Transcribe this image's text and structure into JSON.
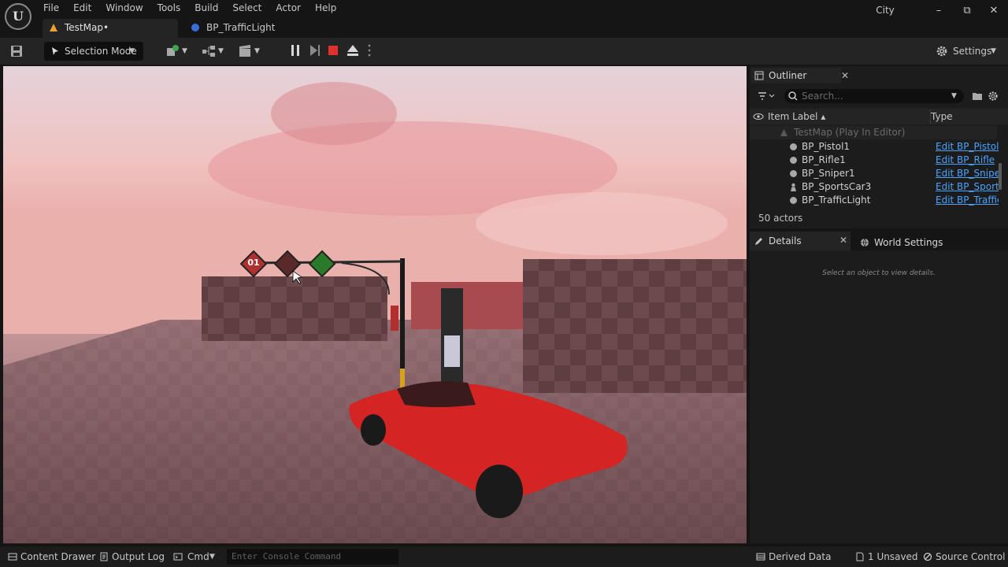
{
  "menu": [
    "File",
    "Edit",
    "Window",
    "Tools",
    "Build",
    "Select",
    "Actor",
    "Help"
  ],
  "project_name": "City",
  "tabs": [
    {
      "label": "TestMap•",
      "icon": "level-icon"
    },
    {
      "label": "BP_TrafficLight",
      "icon": "blueprint-icon"
    }
  ],
  "toolbar": {
    "selection_mode": "Selection Mode",
    "settings_label": "Settings"
  },
  "viewport": {
    "traffic_light_number": "01"
  },
  "outliner": {
    "tab_label": "Outliner",
    "search_placeholder": "Search...",
    "col_label": "Item Label ▴",
    "col_type": "Type",
    "root": "TestMap (Play In Editor)",
    "rows": [
      {
        "name": "BP_Pistol1",
        "type": "Edit BP_Pistol"
      },
      {
        "name": "BP_Rifle1",
        "type": "Edit BP_Rifle"
      },
      {
        "name": "BP_Sniper1",
        "type": "Edit BP_Sniper"
      },
      {
        "name": "BP_SportsCar3",
        "type": "Edit BP_Sports"
      },
      {
        "name": "BP_TrafficLight",
        "type": "Edit BP_Traffic"
      }
    ],
    "actor_count": "50 actors"
  },
  "details": {
    "tab_label": "Details",
    "world_settings_label": "World Settings",
    "empty_message": "Select an object to view details."
  },
  "statusbar": {
    "content_drawer": "Content Drawer",
    "output_log": "Output Log",
    "cmd": "Cmd",
    "console_placeholder": "Enter Console Command",
    "derived_data": "Derived Data",
    "unsaved": "1 Unsaved",
    "source_control": "Source Control"
  },
  "colors": {
    "accent_orange": "#f0a030",
    "link_blue": "#4aa3ff",
    "stop_red": "#e03030",
    "car_red": "#d42424"
  }
}
